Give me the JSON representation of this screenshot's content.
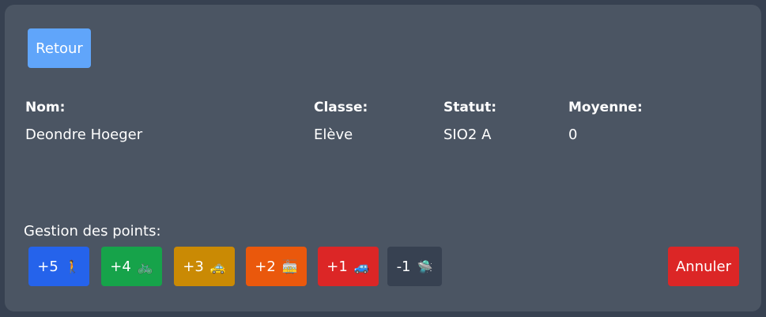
{
  "back_button": {
    "label": "Retour"
  },
  "student": {
    "headers": {
      "name": "Nom:",
      "class": "Classe:",
      "status": "Statut:",
      "average": "Moyenne:"
    },
    "values": {
      "name": "Deondre Hoeger",
      "class": "Elève",
      "status": "SIO2 A",
      "average": "0"
    }
  },
  "points": {
    "title": "Gestion des points:",
    "buttons": [
      {
        "label": "+5",
        "emoji": "🚶",
        "icon": "walking-person-icon",
        "color": "#2563eb"
      },
      {
        "label": "+4",
        "emoji": "🚲",
        "icon": "bicycle-icon",
        "color": "#16a34a"
      },
      {
        "label": "+3",
        "emoji": "🚕",
        "icon": "taxi-icon",
        "color": "#ca8a04"
      },
      {
        "label": "+2",
        "emoji": "🚋",
        "icon": "tram-icon",
        "color": "#ea580c"
      },
      {
        "label": "+1",
        "emoji": "🚙",
        "icon": "car-icon",
        "color": "#dc2626"
      },
      {
        "label": "-1",
        "emoji": "🛸",
        "icon": "ufo-icon",
        "color": "#374151"
      }
    ],
    "cancel_label": "Annuler"
  }
}
